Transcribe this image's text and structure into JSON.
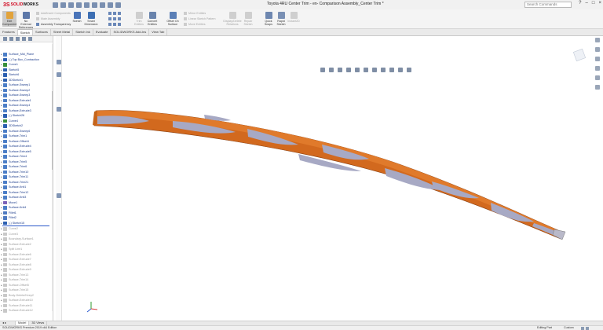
{
  "app": {
    "logo_mark": "3S",
    "logo_brand": "SOLID",
    "logo_brand2": "WORKS"
  },
  "window": {
    "title": "Toyota 4RU Center Trim - en- Comparison Assembly_Center Trim *",
    "search_placeholder": "Search Commands"
  },
  "ribbon": {
    "edit_component": "Edit Component",
    "no_external_references": "No External References",
    "insert_components": "Add/Insert Components",
    "mate_assembly": "Mate Assembly",
    "assembly_transparency": "Assembly Transparency",
    "sketch": "Sketch",
    "smart_dimension": "Smart Dimension",
    "trim": "Trim Entities",
    "convert": "Convert Entities",
    "offset_on_surface": "Offset On Surface",
    "mirror": "Mirror Entities",
    "linear_pattern": "Linear Sketch Pattern",
    "move_entities": "Move Entities",
    "display_delete": "Display/Delete Relations",
    "repair_sketch": "Repair Sketch",
    "quick_snaps": "Quick Snaps",
    "rapid_sketch": "Rapid Sketch",
    "instant2d": "Instant2D",
    "shaded_sketch": "Shaded Sketch Contours"
  },
  "tabs": [
    "Features",
    "Sketch",
    "Surfaces",
    "Sheet Metal",
    "Sketch Ink",
    "Evaluate",
    "SOLIDWORKS Add-Ins",
    "View Tab"
  ],
  "active_tab": "Sketch",
  "tree": [
    {
      "label": "Surface_Mid_Plane",
      "type": "surface"
    },
    {
      "label": "(-) Top Box_Contraction",
      "type": "sketch"
    },
    {
      "label": "Curve1",
      "type": "curve"
    },
    {
      "label": "Sketch5",
      "type": "sketch"
    },
    {
      "label": "Sketch6",
      "type": "sketch"
    },
    {
      "label": "3DSketch1",
      "type": "sketch"
    },
    {
      "label": "Surface-Sweep1",
      "type": "surface"
    },
    {
      "label": "Surface-Sweep2",
      "type": "surface"
    },
    {
      "label": "Surface-Sweep3",
      "type": "surface"
    },
    {
      "label": "Surface-Extrude1",
      "type": "surface"
    },
    {
      "label": "Surface-Sweep4",
      "type": "surface"
    },
    {
      "label": "Surface-Extrude3",
      "type": "surface"
    },
    {
      "label": "(-) Sketch26",
      "type": "sketch"
    },
    {
      "label": "Curve4",
      "type": "curve"
    },
    {
      "label": "3DSketch2",
      "type": "sketch"
    },
    {
      "label": "Surface-Sweep6",
      "type": "surface"
    },
    {
      "label": "Surface-Trim1",
      "type": "surface"
    },
    {
      "label": "Surface-Offset4",
      "type": "surface"
    },
    {
      "label": "Surface-Extrude4",
      "type": "surface"
    },
    {
      "label": "Surface-Extrude5",
      "type": "surface"
    },
    {
      "label": "Surface-Trim4",
      "type": "surface"
    },
    {
      "label": "Surface-Trim5",
      "type": "surface"
    },
    {
      "label": "Surface-Trim6",
      "type": "surface"
    },
    {
      "label": "Surface-Trim10",
      "type": "surface"
    },
    {
      "label": "Surface-Trim11",
      "type": "surface"
    },
    {
      "label": "Surface-Trim21",
      "type": "surface"
    },
    {
      "label": "Surface-Knit1",
      "type": "surface"
    },
    {
      "label": "Surface-Trim12",
      "type": "surface"
    },
    {
      "label": "Surface-Knit3",
      "type": "surface"
    },
    {
      "label": "Move1",
      "type": "move"
    },
    {
      "label": "Surface-Knit4",
      "type": "surface"
    },
    {
      "label": "Fillet1",
      "type": "fillet"
    },
    {
      "label": "Fillet2",
      "type": "fillet"
    },
    {
      "label": "(-) Sketch15",
      "type": "sketch"
    }
  ],
  "tree_suppressed": [
    {
      "label": "Curve2",
      "type": "curve"
    },
    {
      "label": "Curve3",
      "type": "curve"
    },
    {
      "label": "Boundary-Surface1",
      "type": "surface"
    },
    {
      "label": "Surface-Extrude2",
      "type": "surface"
    },
    {
      "label": "Split Line1",
      "type": "split"
    },
    {
      "label": "Surface-Extrude6",
      "type": "surface"
    },
    {
      "label": "Surface-Extrude7",
      "type": "surface"
    },
    {
      "label": "Surface-Extrude8",
      "type": "surface"
    },
    {
      "label": "Surface-Extrude9",
      "type": "surface"
    },
    {
      "label": "Surface-Trim13",
      "type": "surface"
    },
    {
      "label": "Surface-Trim14",
      "type": "surface"
    },
    {
      "label": "Surface-Offset5",
      "type": "surface"
    },
    {
      "label": "Surface-Trim15",
      "type": "surface"
    },
    {
      "label": "Body-Delete/Keep2",
      "type": "body"
    },
    {
      "label": "Surface-Extrude10",
      "type": "surface"
    },
    {
      "label": "Surface-Extrude11",
      "type": "surface"
    },
    {
      "label": "Surface-Extrude12",
      "type": "surface"
    }
  ],
  "bottom_tabs": [
    "Model",
    "3D Views"
  ],
  "active_bottom_tab": "Model",
  "status": {
    "left": "SOLIDWORKS Premium 2019 x64 Edition",
    "editing": "Editing Part",
    "units": "Custom"
  },
  "colors": {
    "part_orange": "#d2691e",
    "part_gray": "#a7a9c4",
    "sketch_blue": "#1a3a8a",
    "rollback_blue": "#2a58c9"
  }
}
